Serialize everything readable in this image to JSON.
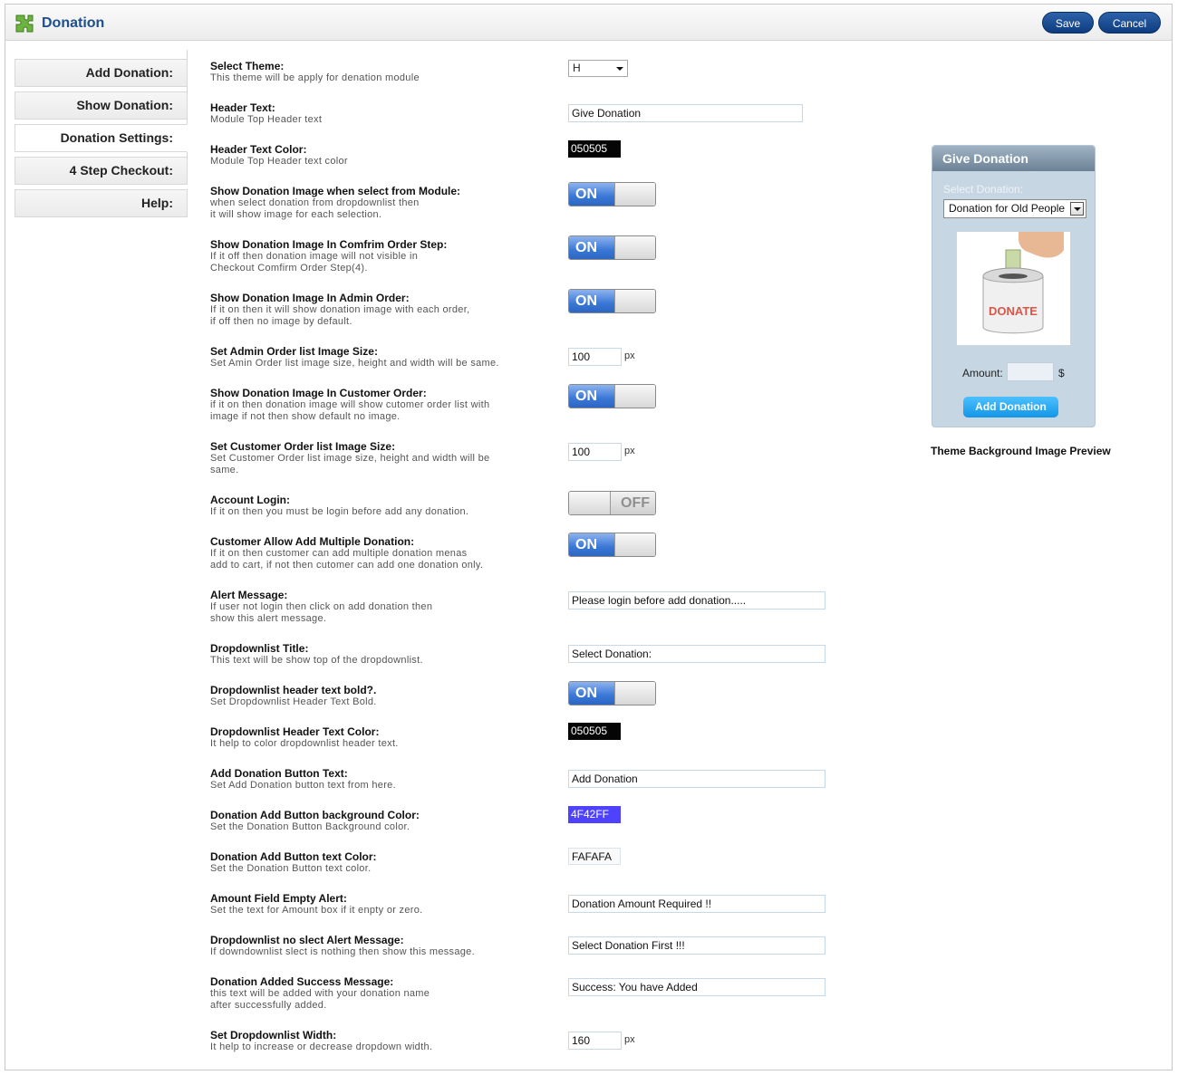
{
  "header": {
    "title": "Donation",
    "save_label": "Save",
    "cancel_label": "Cancel"
  },
  "sidebar": {
    "items": [
      {
        "label": "Add Donation:"
      },
      {
        "label": "Show Donation:"
      },
      {
        "label": "Donation Settings:"
      },
      {
        "label": "4 Step Checkout:"
      },
      {
        "label": "Help:"
      }
    ]
  },
  "settings": [
    {
      "label": "Select Theme:",
      "desc": [
        "This theme will be apply for denation module"
      ],
      "control": "select",
      "value": "H"
    },
    {
      "label": "Header Text:",
      "desc": [
        "Module Top Header text"
      ],
      "control": "text",
      "value": "Give Donation"
    },
    {
      "label": "Header Text Color:",
      "desc": [
        "Module Top Header text color"
      ],
      "control": "color",
      "value": "050505",
      "bg": "#050505",
      "fg": "#ffffff"
    },
    {
      "label": "Show Donation Image when select from Module:",
      "desc": [
        "when select donation from dropdownlist then",
        "it will show image for each selection."
      ],
      "control": "toggle",
      "state": "ON"
    },
    {
      "label": "Show Donation Image In Comfrim Order Step:",
      "desc": [
        "If it off then donation image will not visible in",
        "Checkout Comfirm Order Step(4)."
      ],
      "control": "toggle",
      "state": "ON"
    },
    {
      "label": "Show Donation Image In Admin Order:",
      "desc": [
        "If it on then it will show donation image with each order,",
        "if off then no image by default."
      ],
      "control": "toggle",
      "state": "ON"
    },
    {
      "label": "Set Admin Order list Image Size:",
      "desc": [
        "Set Amin Order list image size, height and width will be same."
      ],
      "control": "number",
      "value": "100",
      "unit": "px"
    },
    {
      "label": "Show Donation Image In Customer Order:",
      "desc": [
        "if it on then donation image will show cutomer order list with",
        "image if not then show default no image."
      ],
      "control": "toggle",
      "state": "ON"
    },
    {
      "label": "Set Customer Order list Image Size:",
      "desc": [
        "Set Customer Order list image size, height and width will be",
        "same."
      ],
      "control": "number",
      "value": "100",
      "unit": "px"
    },
    {
      "label": "Account Login:",
      "desc": [
        "If it on then you must be login before add any donation."
      ],
      "control": "toggle",
      "state": "OFF"
    },
    {
      "label": "Customer Allow Add Multiple Donation:",
      "desc": [
        "If it on then customer can add multiple donation menas",
        "add to cart, if not then cutomer can add one donation only."
      ],
      "control": "toggle",
      "state": "ON"
    },
    {
      "label": "Alert Message:",
      "desc": [
        "If user not login then click on add donation then",
        "show this alert message."
      ],
      "control": "text",
      "value": "Please login before add donation....."
    },
    {
      "label": "Dropdownlist Title:",
      "desc": [
        "This text will be show top of the dropdownlist."
      ],
      "control": "text",
      "value": "Select Donation:"
    },
    {
      "label": "Dropdownlist header text bold?.",
      "desc": [
        "Set Dropdownlist Header Text Bold."
      ],
      "control": "toggle",
      "state": "ON"
    },
    {
      "label": "Dropdownlist Header Text Color:",
      "desc": [
        "It help to color dropdownlist header text."
      ],
      "control": "color",
      "value": "050505",
      "bg": "#050505",
      "fg": "#ffffff"
    },
    {
      "label": "Add Donation Button Text:",
      "desc": [
        "Set Add Donation button text from here."
      ],
      "control": "text",
      "value": "Add Donation"
    },
    {
      "label": "Donation Add Button background Color:",
      "desc": [
        "Set the Donation Button Background color."
      ],
      "control": "color",
      "value": "4F42FF",
      "bg": "#4F42FF",
      "fg": "#ffffff"
    },
    {
      "label": "Donation Add Button text Color:",
      "desc": [
        "Set the Donation Button text color."
      ],
      "control": "color",
      "value": "FAFAFA",
      "bg": "#FAFAFA",
      "fg": "#111111"
    },
    {
      "label": "Amount Field Empty Alert:",
      "desc": [
        "Set the text for Amount box if it enpty or zero."
      ],
      "control": "text",
      "value": "Donation Amount Required !!"
    },
    {
      "label": "Dropdownlist no slect Alert Message:",
      "desc": [
        "If downdownlist slect is nothing then show this message."
      ],
      "control": "text",
      "value": "Select Donation First !!!"
    },
    {
      "label": "Donation Added Success Message:",
      "desc": [
        "this text will be added with your donation name",
        "after successfully added."
      ],
      "control": "text",
      "value": "Success: You have Added"
    },
    {
      "label": "Set Dropdownlist Width:",
      "desc": [
        "It help to increase or decrease dropdown width."
      ],
      "control": "number",
      "value": "160",
      "unit": "px"
    }
  ],
  "preview": {
    "header": "Give Donation",
    "select_label": "Select Donation:",
    "select_value": "Donation for Old People",
    "amount_label": "Amount:",
    "currency": "$",
    "button_label": "Add Donation",
    "image_text": "DONATE",
    "caption": "Theme Background Image Preview"
  },
  "colors": {
    "accent": "#1e4e8c",
    "toggle_on": "#3a77d6",
    "preview_bg": "#c7d6e3",
    "preview_button": "#1296e6"
  }
}
